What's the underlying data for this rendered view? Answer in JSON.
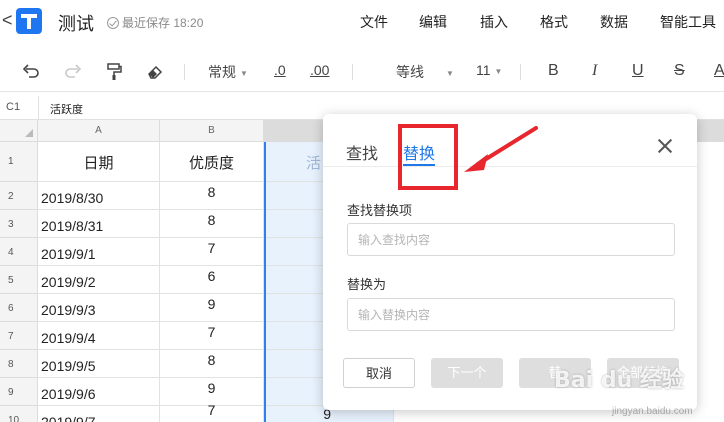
{
  "titlebar": {
    "back_glyph": "<",
    "doc_title": "测试",
    "save_status": "最近保存 18:20",
    "menu": [
      "文件",
      "编辑",
      "插入",
      "格式",
      "数据",
      "智能工具"
    ]
  },
  "toolbar": {
    "format_label": "常规",
    "decimal_decrease": ".0",
    "decimal_increase": ".00",
    "font_family": "等线",
    "font_size": "11",
    "bold": "B",
    "italic": "I",
    "underline": "U",
    "strike": "S",
    "font_color": "A"
  },
  "formula_bar": {
    "cell_ref": "C1",
    "content": "活跃度"
  },
  "grid": {
    "col_headers": [
      "A",
      "B",
      "C"
    ],
    "row_headers": [
      "1",
      "2",
      "3",
      "4",
      "5",
      "6",
      "7",
      "8",
      "9",
      "10"
    ],
    "header_row": [
      "日期",
      "优质度",
      "活"
    ],
    "rows": [
      {
        "date": "2019/8/30",
        "quality": "8"
      },
      {
        "date": "2019/8/31",
        "quality": "8"
      },
      {
        "date": "2019/9/1",
        "quality": "7"
      },
      {
        "date": "2019/9/2",
        "quality": "6"
      },
      {
        "date": "2019/9/3",
        "quality": "9"
      },
      {
        "date": "2019/9/4",
        "quality": "7"
      },
      {
        "date": "2019/9/5",
        "quality": "8"
      },
      {
        "date": "2019/9/6",
        "quality": "9"
      },
      {
        "date": "2019/9/7",
        "quality": "7"
      }
    ],
    "partial_c10": "9"
  },
  "dialog": {
    "tab_find": "查找",
    "tab_replace": "替换",
    "find_label": "查找替换项",
    "find_placeholder": "输入查找内容",
    "replace_label": "替换为",
    "replace_placeholder": "输入替换内容",
    "cancel": "取消",
    "next": "下一个",
    "replace": "替",
    "replace_all": "全部替换"
  },
  "annotation": {
    "color": "#e8262d"
  },
  "watermark": {
    "brand": "Bai du 经验",
    "url": "jingyan.baidu.com"
  }
}
